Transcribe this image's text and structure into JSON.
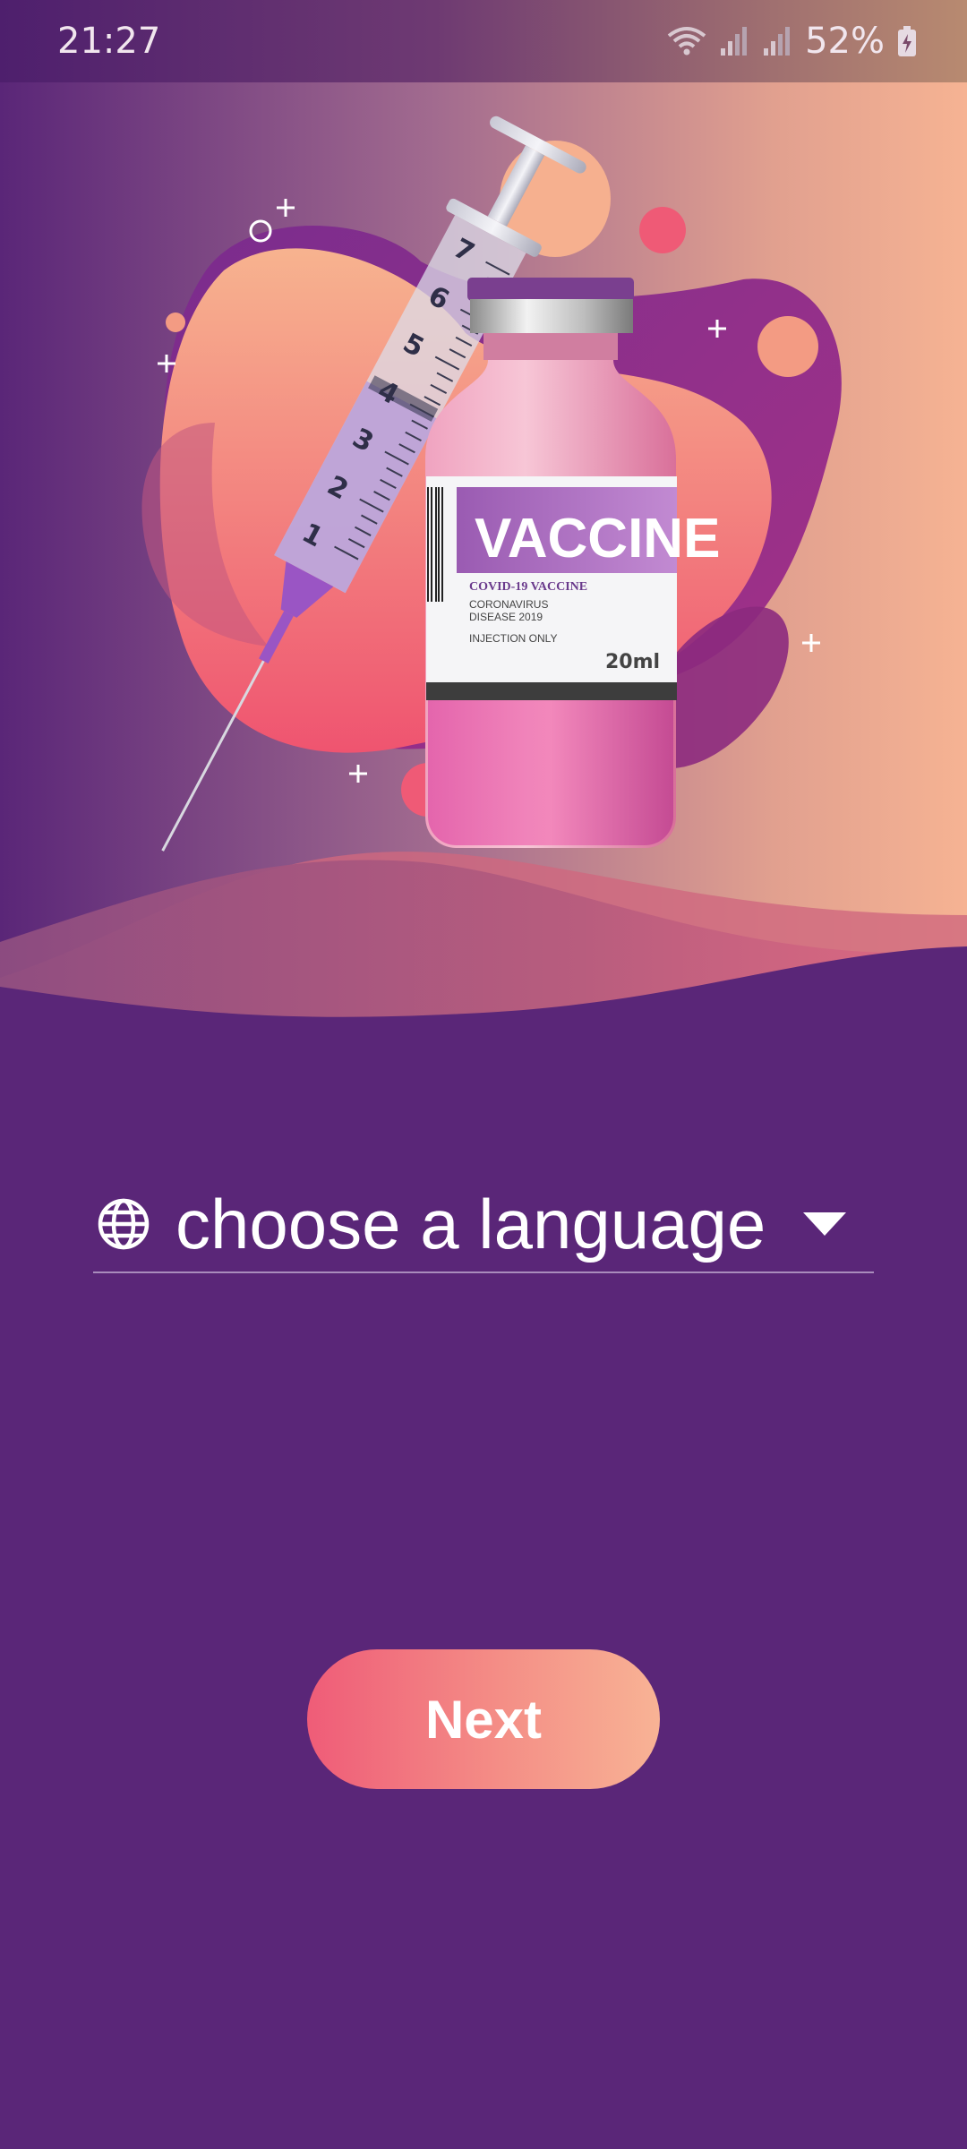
{
  "status_bar": {
    "time": "21:27",
    "battery": "52%",
    "icons": [
      "wifi-icon",
      "signal-icon",
      "signal-icon",
      "battery-charging-icon"
    ]
  },
  "hero": {
    "illustration": "vaccine-vial-and-syringe-illustration",
    "vial_label": {
      "title": "VACCINE",
      "subtitle": "COVID-19 VACCINE",
      "line1": "CORONAVIRUS",
      "line2": "DISEASE 2019",
      "line3": "INJECTION ONLY",
      "volume": "20ml"
    },
    "syringe_marks": [
      "7",
      "6",
      "5",
      "4",
      "3",
      "2",
      "1"
    ]
  },
  "language_selector": {
    "label": "choose a language",
    "icon": "globe-icon",
    "dropdown_icon": "caret-down-icon"
  },
  "next_button": {
    "label": "Next"
  },
  "colors": {
    "background": "#5a2678",
    "button_gradient_start": "#ef5c78",
    "button_gradient_end": "#f8b395",
    "underline": "#a98cbc"
  }
}
